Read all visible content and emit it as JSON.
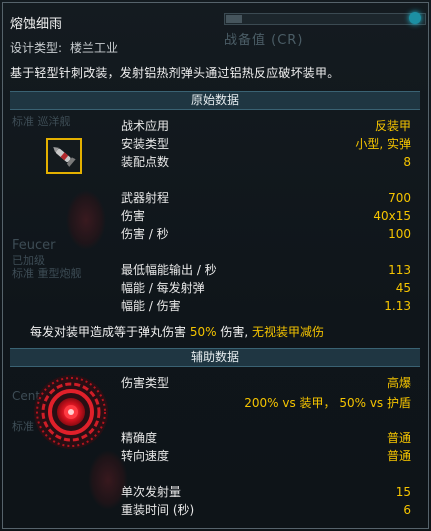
{
  "weapon": {
    "name": "熔蚀细雨",
    "design_label": "设计类型:",
    "design_value": "楼兰工业",
    "description": "基于轻型针刺改装，发射铝热剂弹头通过铝热反应破坏装甲。"
  },
  "background": {
    "panel_title": "战备值 (CR)",
    "ghost_texts": [
      "Feucer",
      "已加级",
      "标准 重型炮舰",
      "标准 巡洋舰",
      "Cent",
      "标准"
    ]
  },
  "sections": {
    "primary": "原始数据",
    "auxiliary": "辅助数据"
  },
  "primary_stats": [
    {
      "label": "战术应用",
      "value": "反装甲"
    },
    {
      "label": "安装类型",
      "value": "小型, 实弹"
    },
    {
      "label": "装配点数",
      "value": "8"
    },
    {
      "label": "武器射程",
      "value": "700"
    },
    {
      "label": "伤害",
      "value": "40x15"
    },
    {
      "label": "伤害 / 秒",
      "value": "100"
    },
    {
      "label": "最低幅能输出 / 秒",
      "value": "113"
    },
    {
      "label": "幅能 / 每发射弹",
      "value": "45"
    },
    {
      "label": "幅能 / 伤害",
      "value": "1.13"
    }
  ],
  "note": {
    "prefix": "每发对装甲造成等于弹丸伤害",
    "percent": "50%",
    "middle": "伤害,",
    "highlight": "无视装甲减伤"
  },
  "aux_stats": [
    {
      "label": "伤害类型",
      "value": "高爆"
    },
    {
      "label": "",
      "value": "200% vs 装甲， 50% vs 护盾"
    },
    {
      "label": "精确度",
      "value": "普通"
    },
    {
      "label": "转向速度",
      "value": "普通"
    },
    {
      "label": "单次发射量",
      "value": "15"
    },
    {
      "label": "重装时间 (秒)",
      "value": "6"
    }
  ],
  "colors": {
    "accent": "#f5c400",
    "section_bg": "#1f3642",
    "damage_icon": "#e0202a"
  },
  "icons": {
    "weapon": "missile-icon",
    "damage_type": "high-explosive-icon"
  }
}
